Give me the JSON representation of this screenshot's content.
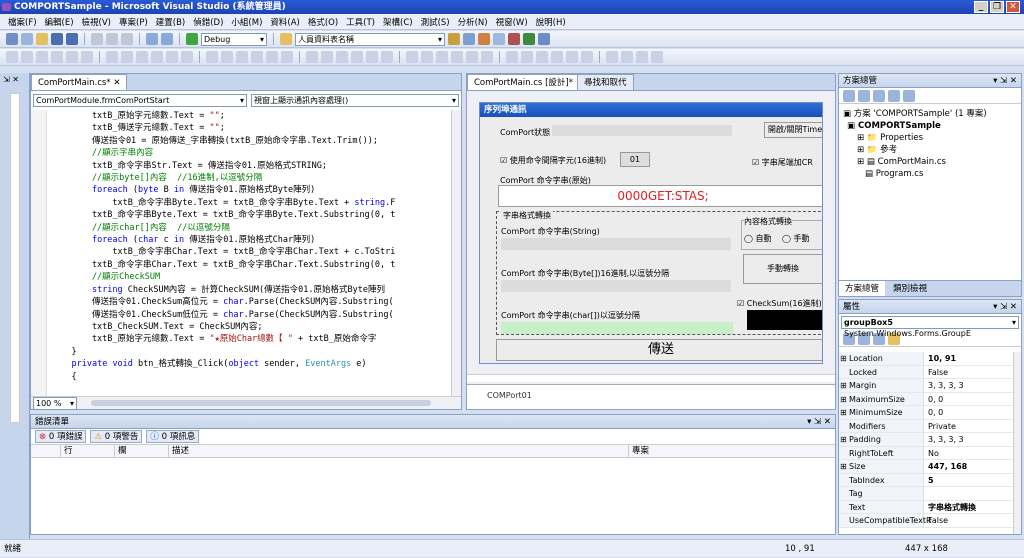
{
  "window": {
    "title": "COMPORTSample - Microsoft Visual Studio (系統管理員)"
  },
  "menu": [
    "檔案(F)",
    "編輯(E)",
    "檢視(V)",
    "專案(P)",
    "建置(B)",
    "偵錯(D)",
    "小組(M)",
    "資料(A)",
    "格式(O)",
    "工具(T)",
    "架構(C)",
    "測試(S)",
    "分析(N)",
    "視窗(W)",
    "說明(H)"
  ],
  "toolbar": {
    "config": "Debug",
    "find_combo": "人員資料表名稱"
  },
  "code_editor": {
    "tab": "ComPortMain.cs*",
    "class_combo": "ComPortModule.frmComPortStart",
    "member_combo": "視窗上顯示通訊內容處理()",
    "zoom": "100 %",
    "lines": [
      "        txtB_原始字元總數.Text = \"\";",
      "        txtB_傳送字元總數.Text = \"\";",
      "        傳送指令01 = 原始傳送_字串轉換(txtB_原始命令字串.Text.Trim());",
      "        //顯示字串內容",
      "        txtB_命令字串Str.Text = 傳送指令01.原始格式STRING;",
      "        //顯示byte[]內容  //16進制,以逗號分隔",
      "        foreach (byte B in 傳送指令01.原始格式Byte陣列)",
      "            txtB_命令字串Byte.Text = txtB_命令字串Byte.Text + string.F",
      "        txtB_命令字串Byte.Text = txtB_命令字串Byte.Text.Substring(0, t",
      "        //顯示char[]內容  //以逗號分隔",
      "        foreach (char c in 傳送指令01.原始格式Char陣列)",
      "            txtB_命令字串Char.Text = txtB_命令字串Char.Text + c.ToStri",
      "        txtB_命令字串Char.Text = txtB_命令字串Char.Text.Substring(0, t",
      "        //顯示CheckSUM",
      "        string CheckSUM內容 = 計算CheckSUM(傳送指令01.原始格式Byte陣列",
      "        傳送指令01.CheckSum高位元 = char.Parse(CheckSUM內容.Substring(",
      "        傳送指令01.CheckSum低位元 = char.Parse(CheckSUM內容.Substring(",
      "        txtB_CheckSUM.Text = CheckSUM內容;",
      "        txtB_原始字元總數.Text = \"★原始Char總數【 \" + txtB_原始命令字",
      "    }",
      "    private void btn_格式轉換_Click(object sender, EventArgs e)",
      "    {"
    ]
  },
  "designer": {
    "tab_design": "ComPortMain.cs [設計]*",
    "tab_find": "尋找和取代",
    "form_title": "序列埠通訊",
    "comport_status_label": "ComPort狀態",
    "open_close_button": "開啟/關閉Time",
    "use_separator_checkbox": "使用命令間隔字元(16進制)",
    "separator_value": "01",
    "append_crlf_checkbox": "字串尾端加CR",
    "raw_command_label": "ComPort 命令字串(原始)",
    "raw_command_value": "0000GET:STAS;",
    "groupbox_title": "字串格式轉換",
    "string_label": "ComPort 命令字串(String)",
    "content_convert_label": "內容格式轉換",
    "auto_radio": "自動",
    "manual_radio": "手動",
    "byte_label": "ComPort 命令字串(Byte[])16進制,以逗號分隔",
    "manual_convert_button": "手動轉換",
    "char_label": "ComPort 命令字串(char[])以逗號分隔",
    "checksum_checkbox": "CheckSum(16進制)",
    "send_button": "傳送",
    "component_tray": "COMPort01"
  },
  "solution_explorer": {
    "title": "方案總管",
    "items": [
      "方案 'COMPORTSample' (1 專案)",
      "COMPORTSample",
      "Properties",
      "參考",
      "ComPortMain.cs",
      "Program.cs"
    ],
    "tabs": [
      "方案總管",
      "類別檢視"
    ]
  },
  "properties": {
    "title": "屬性",
    "object": "groupBox5",
    "object_type": "System.Windows.Forms.GroupE",
    "rows": [
      {
        "name": "Location",
        "value": "10, 91",
        "bold": true,
        "expand": true
      },
      {
        "name": "Locked",
        "value": "False"
      },
      {
        "name": "Margin",
        "value": "3, 3, 3, 3",
        "expand": true
      },
      {
        "name": "MaximumSize",
        "value": "0, 0",
        "expand": true
      },
      {
        "name": "MinimumSize",
        "value": "0, 0",
        "expand": true
      },
      {
        "name": "Modifiers",
        "value": "Private"
      },
      {
        "name": "Padding",
        "value": "3, 3, 3, 3",
        "expand": true
      },
      {
        "name": "RightToLeft",
        "value": "No"
      },
      {
        "name": "Size",
        "value": "447, 168",
        "bold": true,
        "expand": true
      },
      {
        "name": "TabIndex",
        "value": "5",
        "bold": true
      },
      {
        "name": "Tag",
        "value": ""
      },
      {
        "name": "Text",
        "value": "字串格式轉換",
        "bold": true
      },
      {
        "name": "UseCompatibleTextR",
        "value": "False"
      }
    ]
  },
  "error_list": {
    "title": "錯誤清單",
    "errors": "0 項錯誤",
    "warnings": "0 項警告",
    "messages": "0 項訊息",
    "columns": [
      "",
      "行",
      "欄",
      "描述",
      "專案"
    ]
  },
  "status": {
    "left": "就緒",
    "position": "10 , 91",
    "size": "447 x 168"
  }
}
